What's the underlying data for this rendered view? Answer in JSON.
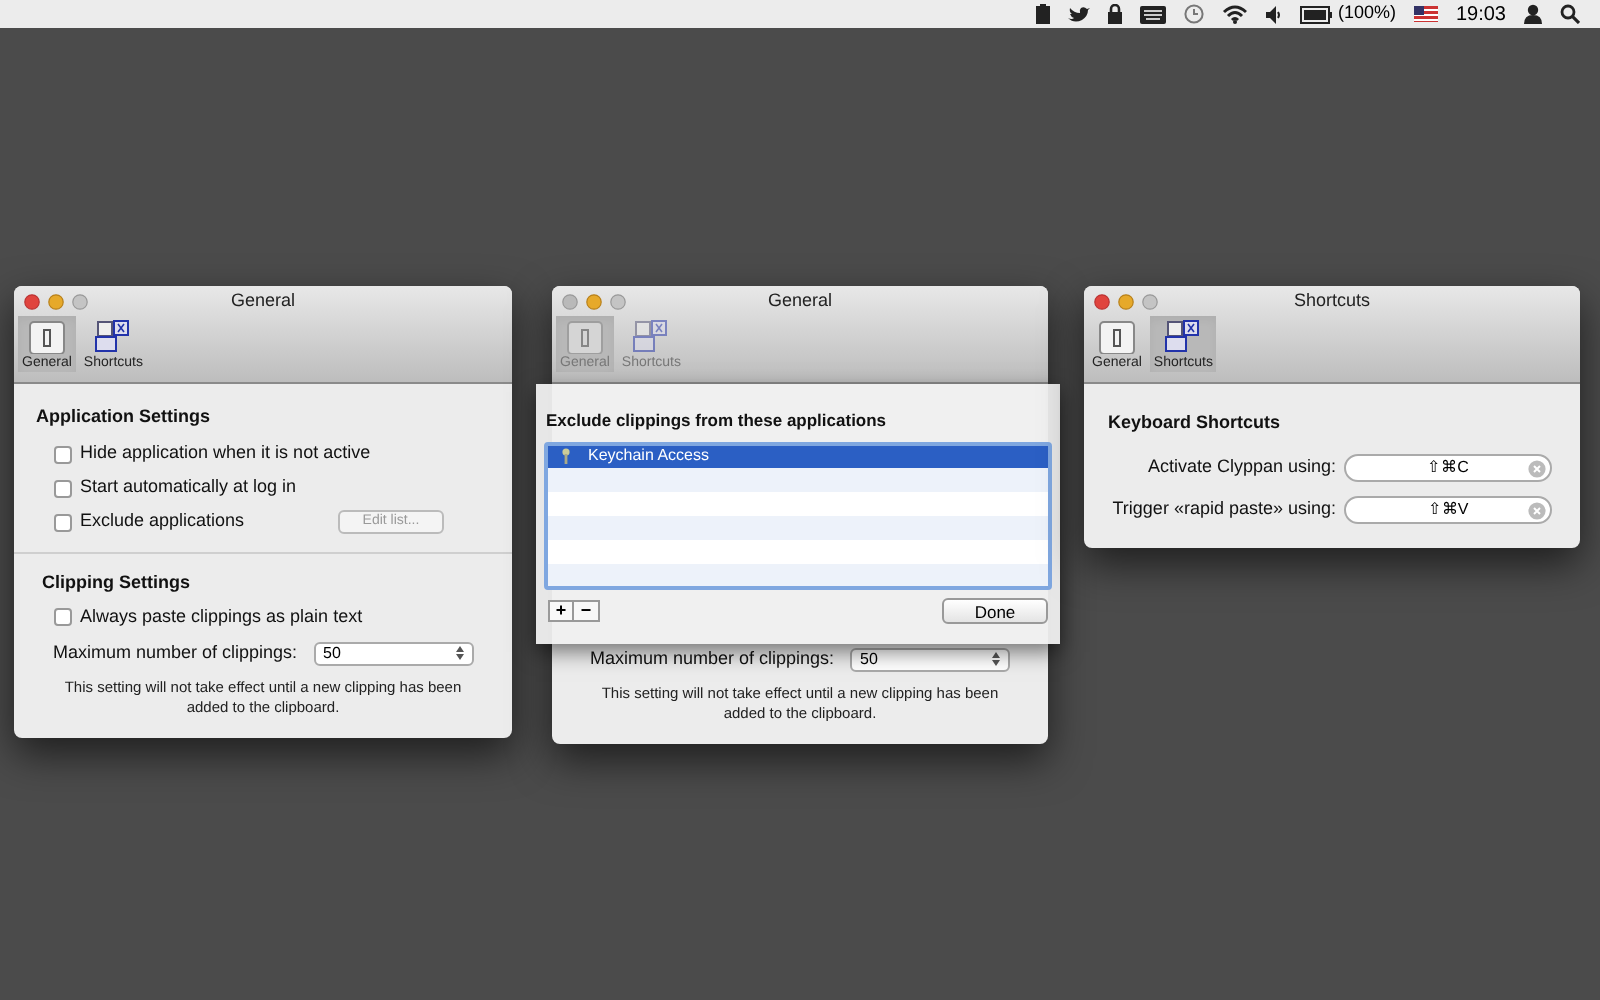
{
  "menubar": {
    "battery": "(100%)",
    "clock": "19:03"
  },
  "windows": [
    {
      "kind": "general",
      "title": "General",
      "close_enabled": true,
      "toolbar_disabled": false,
      "toolbar": [
        {
          "kind": "general",
          "label": "General",
          "selected": true
        },
        {
          "kind": "shortcuts",
          "label": "Shortcuts",
          "selected": false
        }
      ],
      "application_settings": {
        "heading": "Application Settings",
        "options": [
          {
            "label": "Hide application when it is not active",
            "checked": false
          },
          {
            "label": "Start automatically at log in",
            "checked": false
          },
          {
            "label": "Exclude applications",
            "checked": false,
            "button": "Edit list..."
          }
        ]
      },
      "clipping_settings": {
        "heading": "Clipping Settings",
        "options": [
          {
            "label": "Always paste clippings as plain text",
            "checked": false
          }
        ]
      },
      "max_clippings": {
        "label": "Maximum number of clippings:",
        "value": "50"
      },
      "note": "This setting will not take effect until a new clipping has been added to the clipboard."
    },
    {
      "kind": "general_sheet",
      "title": "General",
      "close_enabled": false,
      "toolbar_disabled": true,
      "toolbar": [
        {
          "kind": "general",
          "label": "General",
          "selected": true
        },
        {
          "kind": "shortcuts",
          "label": "Shortcuts",
          "selected": false
        }
      ],
      "max_clippings": {
        "label": "Maximum number of clippings:",
        "value": "50"
      },
      "note": "This setting will not take effect until a new clipping has been added to the clipboard.",
      "sheet": {
        "heading": "Exclude clippings from these applications",
        "items": [
          {
            "label": "Keychain Access",
            "selected": true
          }
        ],
        "add": "+",
        "remove": "−",
        "done": "Done"
      }
    },
    {
      "kind": "shortcuts",
      "title": "Shortcuts",
      "close_enabled": true,
      "toolbar_disabled": false,
      "toolbar": [
        {
          "kind": "general",
          "label": "General",
          "selected": false
        },
        {
          "kind": "shortcuts",
          "label": "Shortcuts",
          "selected": true
        }
      ],
      "heading": "Keyboard Shortcuts",
      "shortcuts": [
        {
          "label": "Activate Clyppan using:",
          "value": "⇧⌘C"
        },
        {
          "label": "Trigger «rapid paste» using:",
          "value": "⇧⌘V"
        }
      ]
    }
  ]
}
